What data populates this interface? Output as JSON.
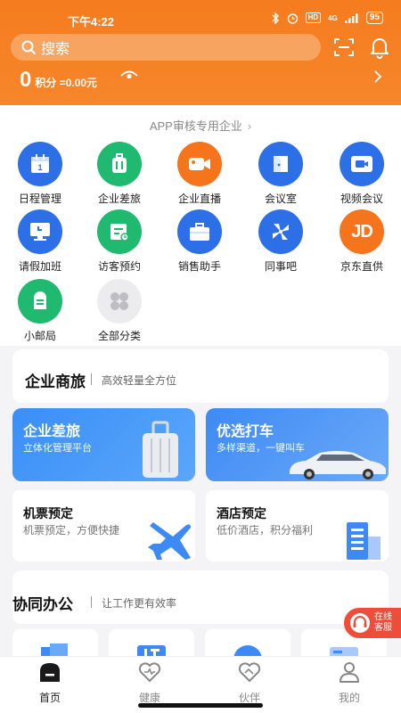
{
  "status_bar": {
    "time": "下午4:22",
    "battery": "95",
    "network": "4G"
  },
  "header": {
    "search_placeholder": "搜索",
    "points_value": "0",
    "points_label": "积分 =0.00元"
  },
  "review_link": {
    "label": "APP审核专用企业"
  },
  "grid": {
    "items": [
      {
        "label": "日程管理",
        "icon": "calendar-icon",
        "color": "#2d6fe6"
      },
      {
        "label": "企业差旅",
        "icon": "luggage-icon",
        "color": "#1fba70"
      },
      {
        "label": "企业直播",
        "icon": "video-camera-icon",
        "color": "#f6741b"
      },
      {
        "label": "会议室",
        "icon": "meeting-room-icon",
        "color": "#2d6fe6"
      },
      {
        "label": "视频会议",
        "icon": "video-meeting-icon",
        "color": "#2d6fe6"
      },
      {
        "label": "请假加班",
        "icon": "monitor-icon",
        "color": "#2d6fe6"
      },
      {
        "label": "访客预约",
        "icon": "visitor-icon",
        "color": "#1fba70"
      },
      {
        "label": "销售助手",
        "icon": "briefcase-icon",
        "color": "#2d6fe6"
      },
      {
        "label": "同事吧",
        "icon": "pinwheel-icon",
        "color": "#2d6fe6"
      },
      {
        "label": "京东直供",
        "icon": "jd-logo-icon",
        "color": "#f6741b"
      },
      {
        "label": "小邮局",
        "icon": "mailbox-icon",
        "color": "#1fba70"
      },
      {
        "label": "全部分类",
        "icon": "all-categories-icon",
        "color": "#ececee"
      }
    ],
    "jd_text": "JD"
  },
  "travel": {
    "title": "企业商旅",
    "subtitle": "高效轻量全方位",
    "banner_trip": {
      "title": "企业差旅",
      "subtitle": "立体化管理平台"
    },
    "banner_taxi": {
      "title": "优选打车",
      "subtitle": "多样渠道，一键叫车"
    },
    "tile_flight": {
      "title": "机票预定",
      "subtitle": "机票预定，方便快捷"
    },
    "tile_hotel": {
      "title": "酒店预定",
      "subtitle": "低价酒店，积分福利"
    }
  },
  "collab": {
    "title": "协同办公",
    "subtitle": "让工作更有效率"
  },
  "customer_service": {
    "line1": "在线",
    "line2": "客服"
  },
  "tabs": [
    {
      "label": "首页",
      "icon": "home-icon",
      "active": true
    },
    {
      "label": "健康",
      "icon": "heart-icon",
      "active": false
    },
    {
      "label": "伙伴",
      "icon": "partner-icon",
      "active": false
    },
    {
      "label": "我的",
      "icon": "user-icon",
      "active": false
    }
  ],
  "colors": {
    "brand_orange": "#f57c1f",
    "blue": "#2d6fe6",
    "green": "#1fba70",
    "cs_red": "#f04c3a"
  }
}
